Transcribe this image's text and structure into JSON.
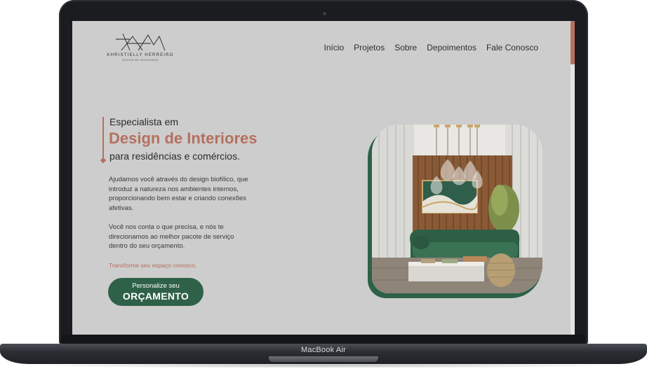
{
  "device": {
    "label": "MacBook Air"
  },
  "site": {
    "logo": {
      "name": "KHRISTIELLY HERREIRO",
      "subtitle": "DESIGN DE INTERIORES"
    },
    "nav": [
      "Início",
      "Projetos",
      "Sobre",
      "Depoimentos",
      "Fale Conosco"
    ],
    "hero": {
      "pre_title": "Especialista em",
      "title": "Design de Interiores",
      "post_title": "para residências e comércios.",
      "paragraph_1": "Ajudamos você através do design biofílico, que introduz a natureza nos ambientes internos, proporcionando bem estar e criando conexões afetivas.",
      "paragraph_2": "Você nos conta o que precisa, e nós te direcionamos ao melhor pacote de serviço dentro do seu orçamento.",
      "cta_text": "Transforme seu espaço conosco.",
      "button_small": "Personalize seu",
      "button_big": "ORÇAMENTO"
    }
  },
  "colors": {
    "accent": "#b5705f",
    "green": "#2e6148",
    "background": "#cdcdcd"
  },
  "icons": {
    "logo": "monogram-mountain-logo",
    "image": "living-room-photo"
  }
}
